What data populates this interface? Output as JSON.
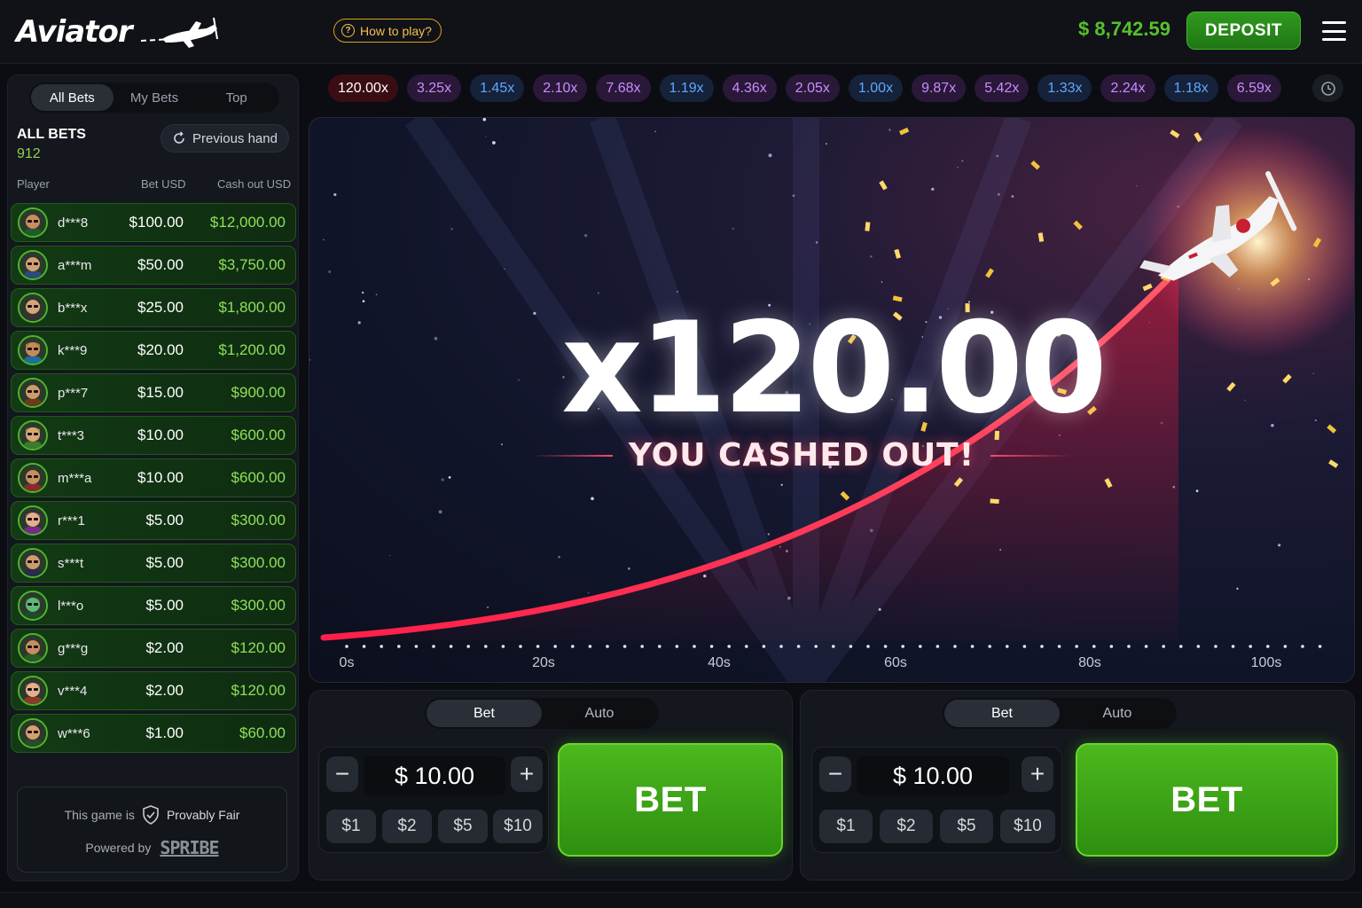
{
  "header": {
    "logo_text": "Aviator",
    "how_to_play": "How to play?",
    "balance": "$ 8,742.59",
    "deposit": "DEPOSIT"
  },
  "sidebar": {
    "tabs": [
      "All Bets",
      "My Bets",
      "Top"
    ],
    "title": "ALL BETS",
    "count": "912",
    "previous_hand": "Previous hand",
    "columns": {
      "player": "Player",
      "bet": "Bet USD",
      "cashout": "Cash out USD"
    },
    "rows": [
      {
        "player": "d***8",
        "bet": "$100.00",
        "cashout": "$12,000.00",
        "skin": "#c98d5e",
        "hair": "#3b2415",
        "shirt": "#1e5a2a"
      },
      {
        "player": "a***m",
        "bet": "$50.00",
        "cashout": "$3,750.00",
        "skin": "#d5a071",
        "hair": "#1f1f1f",
        "shirt": "#2c4a7a"
      },
      {
        "player": "b***x",
        "bet": "$25.00",
        "cashout": "$1,800.00",
        "skin": "#d8a37a",
        "hair": "#1a1a1a",
        "shirt": "#333333"
      },
      {
        "player": "k***9",
        "bet": "$20.00",
        "cashout": "$1,200.00",
        "skin": "#c68a5a",
        "hair": "#d9a027",
        "shirt": "#1d6f9e"
      },
      {
        "player": "p***7",
        "bet": "$15.00",
        "cashout": "$900.00",
        "skin": "#cf9a6c",
        "hair": "#222222",
        "shirt": "#6a3b1f"
      },
      {
        "player": "t***3",
        "bet": "$10.00",
        "cashout": "$600.00",
        "skin": "#d9a675",
        "hair": "#e0b030",
        "shirt": "#3d7a2a"
      },
      {
        "player": "m***a",
        "bet": "$10.00",
        "cashout": "$600.00",
        "skin": "#c98d5e",
        "hair": "#4a2a18",
        "shirt": "#8a2a2a"
      },
      {
        "player": "r***1",
        "bet": "$5.00",
        "cashout": "$300.00",
        "skin": "#e2b08a",
        "hair": "#c23fb0",
        "shirt": "#7a2a8a"
      },
      {
        "player": "s***t",
        "bet": "$5.00",
        "cashout": "$300.00",
        "skin": "#cf9a6c",
        "hair": "#1c2a4a",
        "shirt": "#2a2a4a"
      },
      {
        "player": "l***o",
        "bet": "$5.00",
        "cashout": "$300.00",
        "skin": "#5fb878",
        "hair": "#2b7a3a",
        "shirt": "#1f4a2a"
      },
      {
        "player": "g***g",
        "bet": "$2.00",
        "cashout": "$120.00",
        "skin": "#c98d5e",
        "hair": "#3b2415",
        "shirt": "#2a5a2a"
      },
      {
        "player": "v***4",
        "bet": "$2.00",
        "cashout": "$120.00",
        "skin": "#e2b08a",
        "hair": "#a0522d",
        "shirt": "#8a3a2a"
      },
      {
        "player": "w***6",
        "bet": "$1.00",
        "cashout": "$60.00",
        "skin": "#d5a071",
        "hair": "#2a1a10",
        "shirt": "#2a4a2a"
      }
    ],
    "fair_prefix": "This game is",
    "fair_label": "Provably Fair",
    "powered_by": "Powered by",
    "brand": "SPRIBE"
  },
  "history": [
    {
      "value": "120.00x",
      "tone": "red"
    },
    {
      "value": "3.25x",
      "tone": "purple"
    },
    {
      "value": "1.45x",
      "tone": "blue"
    },
    {
      "value": "2.10x",
      "tone": "purple"
    },
    {
      "value": "7.68x",
      "tone": "purple"
    },
    {
      "value": "1.19x",
      "tone": "blue"
    },
    {
      "value": "4.36x",
      "tone": "purple"
    },
    {
      "value": "2.05x",
      "tone": "purple"
    },
    {
      "value": "1.00x",
      "tone": "blue"
    },
    {
      "value": "9.87x",
      "tone": "purple"
    },
    {
      "value": "5.42x",
      "tone": "purple"
    },
    {
      "value": "1.33x",
      "tone": "blue"
    },
    {
      "value": "2.24x",
      "tone": "purple"
    },
    {
      "value": "1.18x",
      "tone": "blue"
    },
    {
      "value": "6.59x",
      "tone": "purple"
    }
  ],
  "game": {
    "multiplier": "x120.00",
    "message": "YOU CASHED OUT!",
    "axis": [
      "0s",
      "20s",
      "40s",
      "60s",
      "80s",
      "100s"
    ]
  },
  "panels": [
    {
      "tabs": [
        "Bet",
        "Auto"
      ],
      "amount": "$ 10.00",
      "quick": [
        "$1",
        "$2",
        "$5",
        "$10"
      ],
      "bet_label": "BET"
    },
    {
      "tabs": [
        "Bet",
        "Auto"
      ],
      "amount": "$ 10.00",
      "quick": [
        "$1",
        "$2",
        "$5",
        "$10"
      ],
      "bet_label": "BET"
    }
  ],
  "colors": {
    "accent_green": "#4cb81e",
    "cashout_green": "#8fe05a",
    "balance_green": "#56c12c",
    "curve_red": "#ff2a4a"
  }
}
